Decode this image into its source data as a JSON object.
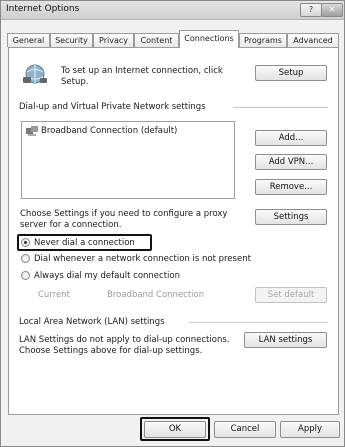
{
  "window": {
    "title": "Internet Options",
    "help_btn": "?",
    "close_btn": "✕"
  },
  "tabs": [
    "General",
    "Security",
    "Privacy",
    "Content",
    "Connections",
    "Programs",
    "Advanced"
  ],
  "active_tab": "Connections",
  "setup": {
    "text_line1": "To set up an Internet connection, click",
    "text_line2": "Setup.",
    "button": "Setup"
  },
  "dialup": {
    "heading": "Dial-up and Virtual Private Network settings",
    "list_items": [
      "Broadband Connection (default)"
    ],
    "add_button": "Add...",
    "add_vpn_button": "Add VPN...",
    "remove_button": "Remove...",
    "settings_text_line1": "Choose Settings if you need to configure a proxy",
    "settings_text_line2": "server for a connection.",
    "settings_button": "Settings"
  },
  "radios": [
    {
      "label": "Never dial a connection",
      "checked": true
    },
    {
      "label": "Dial whenever a network connection is not present",
      "checked": false
    },
    {
      "label": "Always dial my default connection",
      "checked": false
    }
  ],
  "current": {
    "label": "Current",
    "value": "Broadband Connection",
    "button": "Set default"
  },
  "lan": {
    "heading": "Local Area Network (LAN) settings",
    "text_line1": "LAN Settings do not apply to dial-up connections.",
    "text_line2": "Choose Settings above for dial-up settings.",
    "button": "LAN settings"
  },
  "footer": {
    "ok": "OK",
    "cancel": "Cancel",
    "apply": "Apply"
  }
}
